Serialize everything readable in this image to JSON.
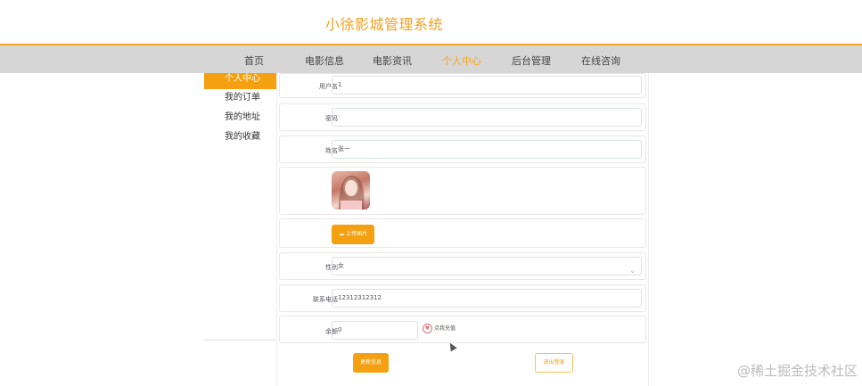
{
  "header": {
    "title": "小徐影城管理系统"
  },
  "nav": {
    "items": [
      "首页",
      "电影信息",
      "电影资讯",
      "个人中心",
      "后台管理",
      "在线咨询"
    ],
    "active_index": 3
  },
  "sidebar": {
    "items": [
      "个人中心",
      "我的订单",
      "我的地址",
      "我的收藏"
    ],
    "active_index": 0
  },
  "form": {
    "username": {
      "label": "用户名",
      "value": "1"
    },
    "password": {
      "label": "密码",
      "value": "·"
    },
    "name": {
      "label": "姓名",
      "value": "张一"
    },
    "avatar": {
      "upload_label": "上传图片"
    },
    "gender": {
      "label": "性别",
      "value": "女"
    },
    "phone": {
      "label": "联系电话",
      "value": "12312312312"
    },
    "balance": {
      "label": "余额",
      "value": "0",
      "recharge_label": "点我充值"
    },
    "update_label": "更新信息",
    "logout_label": "退出登录"
  },
  "watermark": "@稀土掘金技术社区",
  "colors": {
    "accent": "#f5a010",
    "nav_bg": "#d6d6d6"
  },
  "icons": {
    "upload": "cloud-upload-icon",
    "recharge": "heart-icon",
    "select": "chevron-down-icon"
  }
}
